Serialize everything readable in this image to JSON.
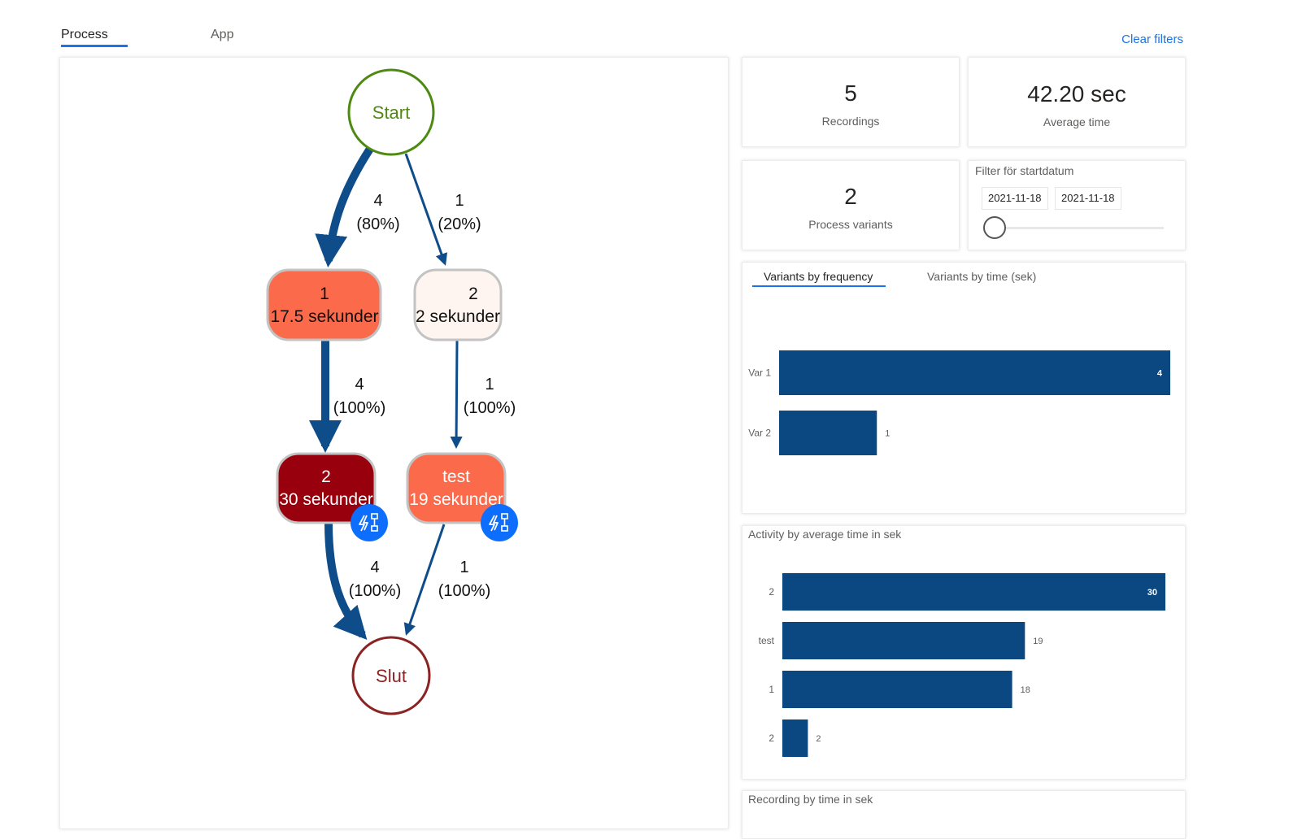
{
  "tabs": [
    {
      "label": "Process",
      "active": true
    },
    {
      "label": "App",
      "active": false
    }
  ],
  "clear_filters_label": "Clear filters",
  "colors": {
    "accent": "#1a73e8",
    "bar": "#0b4780",
    "edge": "#0f4c8a",
    "start": "#4e8a11",
    "end": "#8b2323",
    "badge": "#0d6efd"
  },
  "process_map": {
    "start_label": "Start",
    "end_label": "Slut",
    "nodes": [
      {
        "id": "n1",
        "title": "1",
        "subtitle": "17.5 sekunder",
        "fill": "#fb6a4a",
        "text_color": "#111111",
        "badge": false
      },
      {
        "id": "n2",
        "title": "2",
        "subtitle": "2 sekunder",
        "fill": "#fff5f0",
        "text_color": "#111111",
        "badge": false
      },
      {
        "id": "n3",
        "title": "2",
        "subtitle": "30 sekunder",
        "fill": "#99000d",
        "text_color": "#ffffff",
        "badge": true,
        "badge_icon": "automation-flow-icon"
      },
      {
        "id": "n4",
        "title": "test",
        "subtitle": "19 sekunder",
        "fill": "#fb6a4a",
        "text_color": "#ffffff",
        "badge": true,
        "badge_icon": "automation-flow-icon"
      }
    ],
    "edges": [
      {
        "from": "start",
        "to": "n1",
        "count": "4",
        "pct": "(80%)",
        "weight": 4
      },
      {
        "from": "start",
        "to": "n2",
        "count": "1",
        "pct": "(20%)",
        "weight": 1
      },
      {
        "from": "n1",
        "to": "n3",
        "count": "4",
        "pct": "(100%)",
        "weight": 4
      },
      {
        "from": "n2",
        "to": "n4",
        "count": "1",
        "pct": "(100%)",
        "weight": 1
      },
      {
        "from": "n3",
        "to": "end",
        "count": "4",
        "pct": "(100%)",
        "weight": 4
      },
      {
        "from": "n4",
        "to": "end",
        "count": "1",
        "pct": "(100%)",
        "weight": 1
      }
    ]
  },
  "kpis": {
    "recordings": {
      "value": "5",
      "label": "Recordings"
    },
    "average_time": {
      "value": "42.20 sec",
      "label": "Average time"
    },
    "process_variants": {
      "value": "2",
      "label": "Process variants"
    }
  },
  "date_filter": {
    "title": "Filter för startdatum",
    "start": "2021-11-18",
    "end": "2021-11-18",
    "slider_position": 0
  },
  "variants_panel": {
    "tabs": [
      {
        "label": "Variants by frequency",
        "active": true
      },
      {
        "label": "Variants by time (sek)",
        "active": false
      }
    ]
  },
  "activity_panel": {
    "title": "Activity by average time in sek"
  },
  "recording_panel": {
    "title": "Recording by time in sek"
  },
  "chart_data": [
    {
      "type": "bar",
      "orientation": "horizontal",
      "title": "Variants by frequency",
      "categories": [
        "Var 1",
        "Var 2"
      ],
      "values": [
        4,
        1
      ],
      "xlim": [
        0,
        4
      ],
      "grid": false,
      "data_labels": true
    },
    {
      "type": "bar",
      "orientation": "horizontal",
      "title": "Activity by average time in sek",
      "categories": [
        "2",
        "test",
        "1",
        "2"
      ],
      "values": [
        30,
        19,
        18,
        2
      ],
      "xlim": [
        0,
        30
      ],
      "grid": false,
      "data_labels": true
    }
  ]
}
